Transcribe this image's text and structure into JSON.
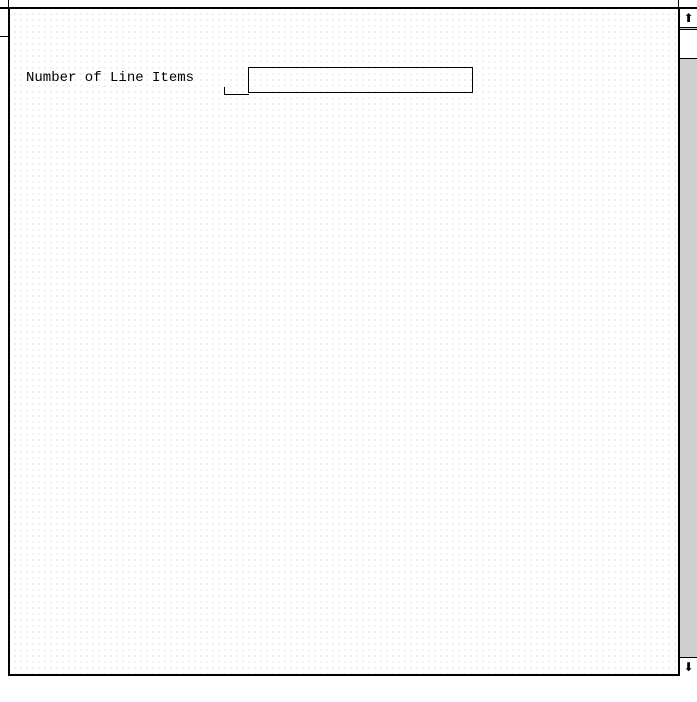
{
  "form": {
    "fields": [
      {
        "label": "Number of Line Items",
        "value": ""
      }
    ]
  },
  "scrollbar": {
    "up_icon": "arrow-up-icon",
    "down_icon": "arrow-down-icon",
    "up_glyph": "⬆",
    "down_glyph": "⬇"
  }
}
